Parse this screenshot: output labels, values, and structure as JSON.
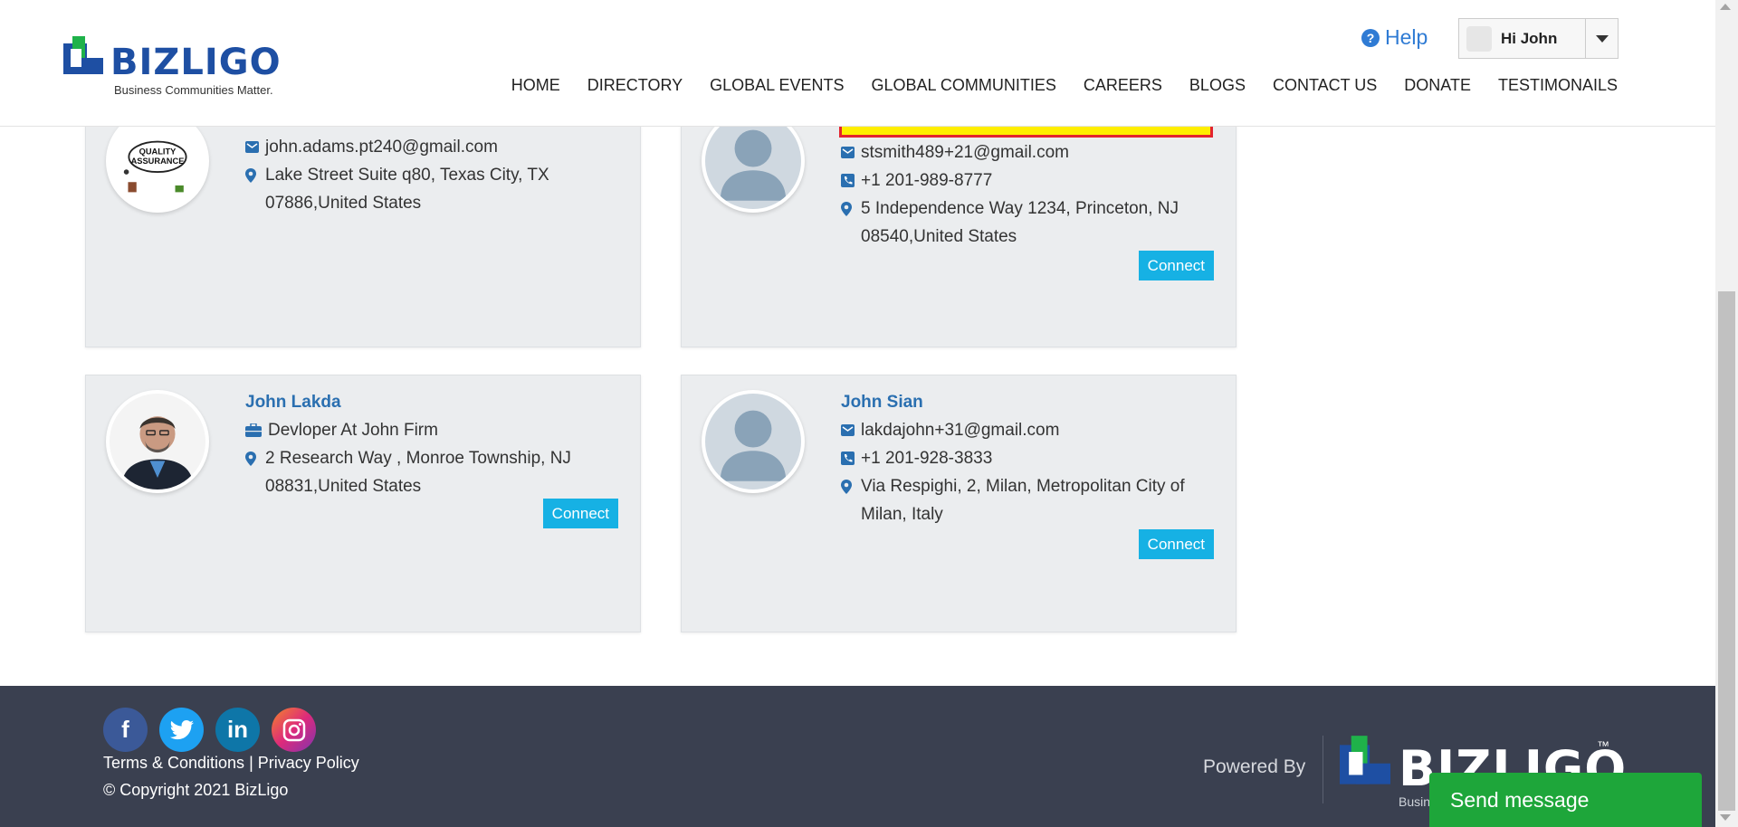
{
  "header": {
    "logo_text": "BIZLIGO",
    "logo_tagline": "Business Communities Matter.",
    "help_label": "Help",
    "user_greeting": "Hi John",
    "nav": [
      "HOME",
      "DIRECTORY",
      "GLOBAL EVENTS",
      "GLOBAL COMMUNITIES",
      "CAREERS",
      "BLOGS",
      "CONTACT US",
      "DONATE",
      "TESTIMONAILS"
    ]
  },
  "cards": [
    {
      "avatar": "quality-assurance-image",
      "email": "john.adams.pt240@gmail.com",
      "address": "Lake Street Suite q80, Texas City, TX 07886,United States"
    },
    {
      "avatar": "default-user-icon",
      "email": "stsmith489+21@gmail.com",
      "phone": "+1 201-989-8777",
      "address": "5 Independence Way 1234, Princeton, NJ 08540,United States",
      "connect_label": "Connect"
    },
    {
      "avatar": "man-in-suit-photo",
      "name": "John Lakda",
      "job": "Devloper At John Firm",
      "address": "2 Research Way , Monroe Township, NJ 08831,United States",
      "connect_label": "Connect"
    },
    {
      "avatar": "default-user-icon",
      "name": "John Sian",
      "email": "lakdajohn+31@gmail.com",
      "phone": "+1 201-928-3833",
      "address": "Via Respighi, 2, Milan, Metropolitan City of Milan, Italy",
      "connect_label": "Connect"
    }
  ],
  "footer": {
    "terms": "Terms & Conditions",
    "separator": "|",
    "privacy": "Privacy Policy",
    "copyright": "© Copyright 2021 BizLigo",
    "powered_by": "Powered By",
    "logo_text": "BIZLIGO",
    "logo_tm": "™",
    "logo_tag_fragment": "Busin"
  },
  "chat": {
    "send_message": "Send message"
  },
  "colors": {
    "brand_blue": "#1e4fa3",
    "link_blue": "#2a6fb0",
    "connect": "#16b1e4",
    "footer_bg": "#3a4050",
    "chat_green": "#1ea63a",
    "highlight_yellow": "#ffee00",
    "highlight_red": "#e3232e"
  }
}
